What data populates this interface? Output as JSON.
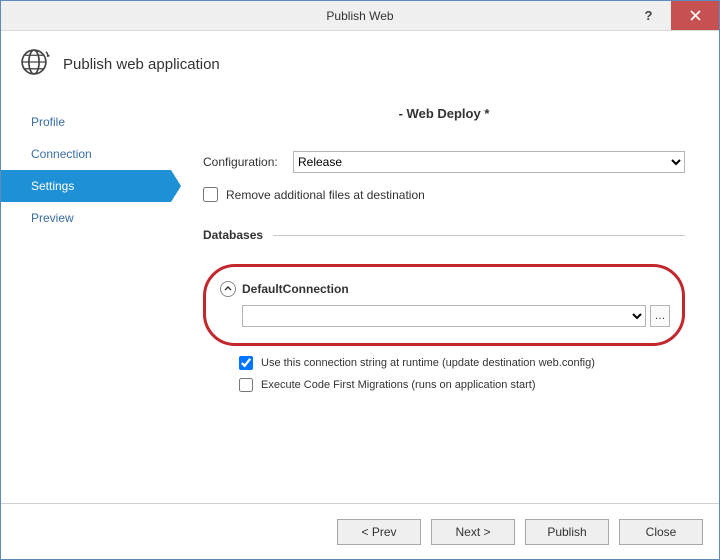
{
  "window": {
    "title": "Publish Web"
  },
  "header": {
    "text": "Publish web application"
  },
  "sidebar": {
    "items": [
      {
        "label": "Profile"
      },
      {
        "label": "Connection"
      },
      {
        "label": "Settings"
      },
      {
        "label": "Preview"
      }
    ],
    "selectedIndex": 2
  },
  "main": {
    "title": "- Web Deploy *",
    "configLabel": "Configuration:",
    "configValue": "Release",
    "removeFilesLabel": "Remove additional files at destination",
    "removeFilesChecked": false,
    "databasesHeading": "Databases",
    "defaultConnection": {
      "name": "DefaultConnection",
      "connectionString": "",
      "ellipsis": "…",
      "useRuntimeLabel": "Use this connection string at runtime (update destination web.config)",
      "useRuntimeChecked": true,
      "codeFirstLabel": "Execute Code First Migrations (runs on application start)",
      "codeFirstChecked": false
    }
  },
  "footer": {
    "prev": "< Prev",
    "next": "Next >",
    "publish": "Publish",
    "close": "Close"
  }
}
